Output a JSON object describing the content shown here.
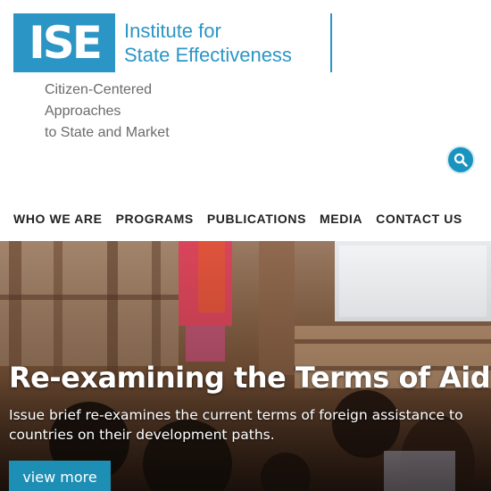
{
  "logo": {
    "abbr": "ISE",
    "name_line1": "Institute for",
    "name_line2": "State Effectiveness"
  },
  "tagline": {
    "line1": "Citizen-Centered",
    "line2": "Approaches",
    "line3": "to State and Market"
  },
  "search": {
    "icon": "search-icon"
  },
  "nav": {
    "items": [
      {
        "label": "WHO WE ARE"
      },
      {
        "label": "PROGRAMS"
      },
      {
        "label": "PUBLICATIONS"
      },
      {
        "label": "MEDIA"
      },
      {
        "label": "CONTACT US"
      }
    ]
  },
  "hero": {
    "title": "Re-examining the Terms of Aid",
    "description": "Issue brief re-examines the current terms of foreign assistance to countries on their development paths.",
    "button_label": "view more"
  },
  "colors": {
    "brand_blue": "#2b96c6",
    "button_blue": "#1e8fb4",
    "nav_text": "#222222",
    "tagline_gray": "#6b6b6b"
  }
}
